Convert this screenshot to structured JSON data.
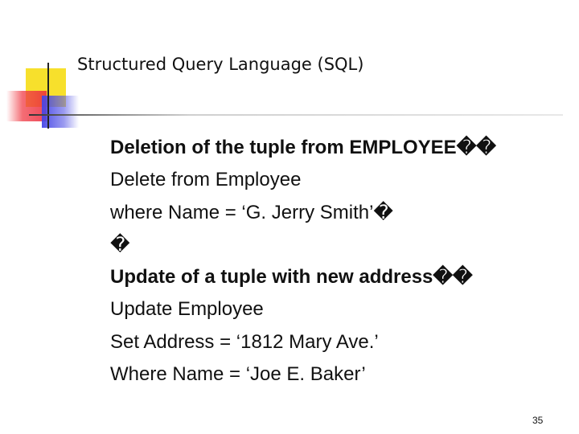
{
  "slide": {
    "title": "Structured Query Language (SQL)",
    "lines": [
      "Deletion of  the tuple from EMPLOYEE��",
      "Delete from Employee",
      "where Name = ‘G. Jerry Smith’�",
      "�",
      "Update of a tuple with new address��",
      "Update Employee",
      "Set Address = ‘1812 Mary Ave.’",
      "Where Name = ‘Joe E. Baker’"
    ],
    "page_number": "35"
  },
  "colors": {
    "accent_yellow": "#f7e02c",
    "accent_red": "#eb283c",
    "accent_blue": "#4646e6"
  }
}
